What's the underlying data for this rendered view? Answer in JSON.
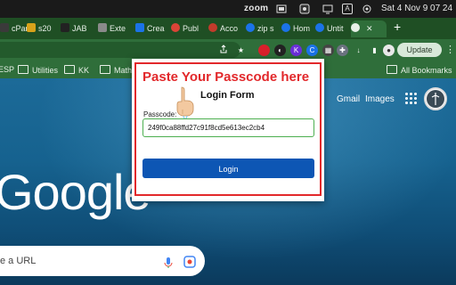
{
  "menubar": {
    "zoom_label": "zoom",
    "a_indicator": "A",
    "clock": "Sat 4 Nov  9 07 24"
  },
  "tabs": [
    {
      "label": "cPar",
      "color": "#3a3a3a"
    },
    {
      "label": "s20",
      "color": "#d8a21a"
    },
    {
      "label": "JAB",
      "color": "#222222"
    },
    {
      "label": "Exte",
      "color": "#8a8a8a"
    },
    {
      "label": "Crea",
      "color": "#1b73e8"
    },
    {
      "label": "Publ",
      "color": "#db4437"
    },
    {
      "label": "Acco",
      "color": "#c23b2b"
    },
    {
      "label": "zip s",
      "color": "#1b73e8"
    },
    {
      "label": "Hom",
      "color": "#1b73e8"
    },
    {
      "label": "Untit",
      "color": "#1b73e8"
    }
  ],
  "new_tab_label": "+",
  "toolbar": {
    "update_label": "Update"
  },
  "bookmarks": {
    "items": [
      "ESP",
      "Utilities",
      "KK",
      "Math"
    ],
    "all_label": "All Bookmarks"
  },
  "ntp": {
    "gmail_label": "Gmail",
    "images_label": "Images",
    "logo_text": "Google",
    "search_placeholder": "e a URL"
  },
  "popup": {
    "banner": "Paste Your Passcode here",
    "title": "Login Form",
    "passcode_label": "Passcode:",
    "passcode_value": "249f0ca88ffd27c91f8cd5e613ec2cb4",
    "login_label": "Login"
  },
  "colors": {
    "accent_red": "#e2282b",
    "login_blue": "#0d56b4",
    "chrome_green": "#2f6e3a"
  }
}
